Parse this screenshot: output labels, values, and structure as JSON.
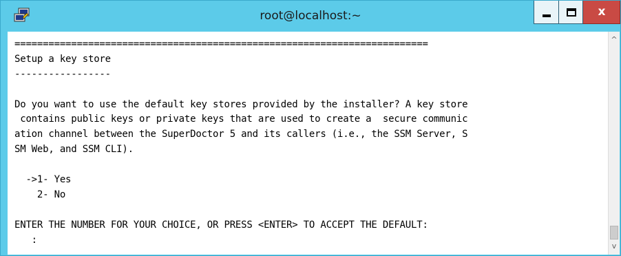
{
  "window": {
    "title": "root@localhost:~",
    "accent_color": "#5ccbe9",
    "close_color": "#c94a44"
  },
  "titlebar": {
    "app_icon": "putty-icon",
    "buttons": {
      "minimize_icon": "minimize-icon",
      "maximize_icon": "maximize-icon",
      "close_label": "x"
    }
  },
  "terminal": {
    "lines": [
      "=========================================================================",
      "Setup a key store",
      "-----------------",
      "",
      "Do you want to use the default key stores provided by the installer? A key store",
      " contains public keys or private keys that are used to create a  secure communic",
      "ation channel between the SuperDoctor 5 and its callers (i.e., the SSM Server, S",
      "SM Web, and SSM CLI).",
      "",
      "  ->1- Yes",
      "    2- No",
      "",
      "ENTER THE NUMBER FOR YOUR CHOICE, OR PRESS <ENTER> TO ACCEPT THE DEFAULT:",
      "   :"
    ]
  },
  "scrollbar": {
    "up_arrow": "^",
    "down_arrow": "v"
  }
}
